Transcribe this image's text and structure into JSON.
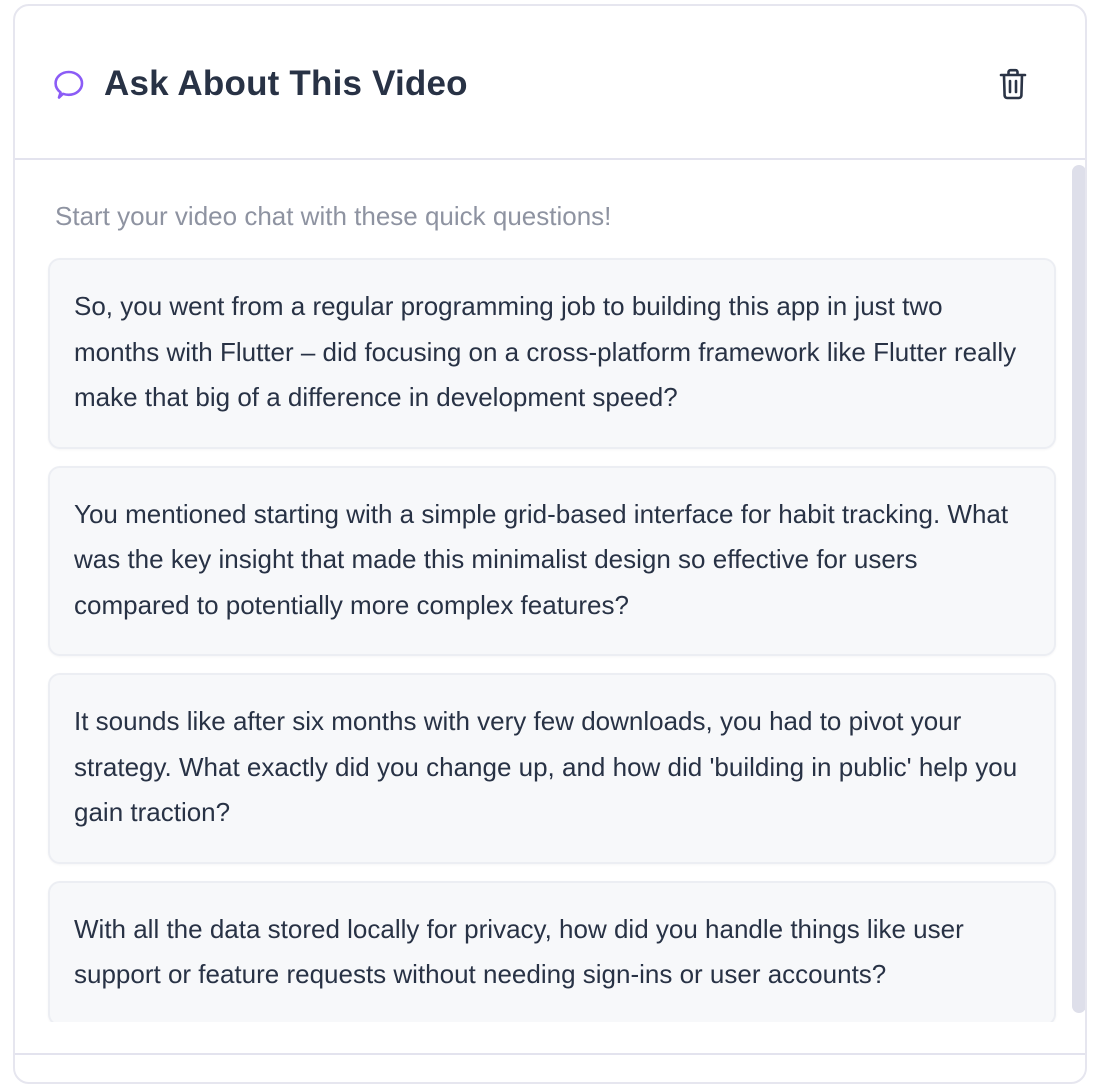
{
  "header": {
    "title": "Ask About This Video",
    "icon": "chat-bubble-icon",
    "delete_icon": "trash-icon",
    "accent_color": "#8b5cf6"
  },
  "body": {
    "hint": "Start your video chat with these quick questions!",
    "questions": [
      "So, you went from a regular programming job to building this app in just two months with Flutter – did focusing on a cross-platform framework like Flutter really make that big of a difference in development speed?",
      "You mentioned starting with a simple grid-based interface for habit tracking. What was the key insight that made this minimalist design so effective for users compared to potentially more complex features?",
      "It sounds like after six months with very few downloads, you had to pivot your strategy. What exactly did you change up, and how did 'building in public' help you gain traction?",
      "With all the data stored locally for privacy, how did you handle things like user support or feature requests without needing sign-ins or user accounts?"
    ]
  }
}
